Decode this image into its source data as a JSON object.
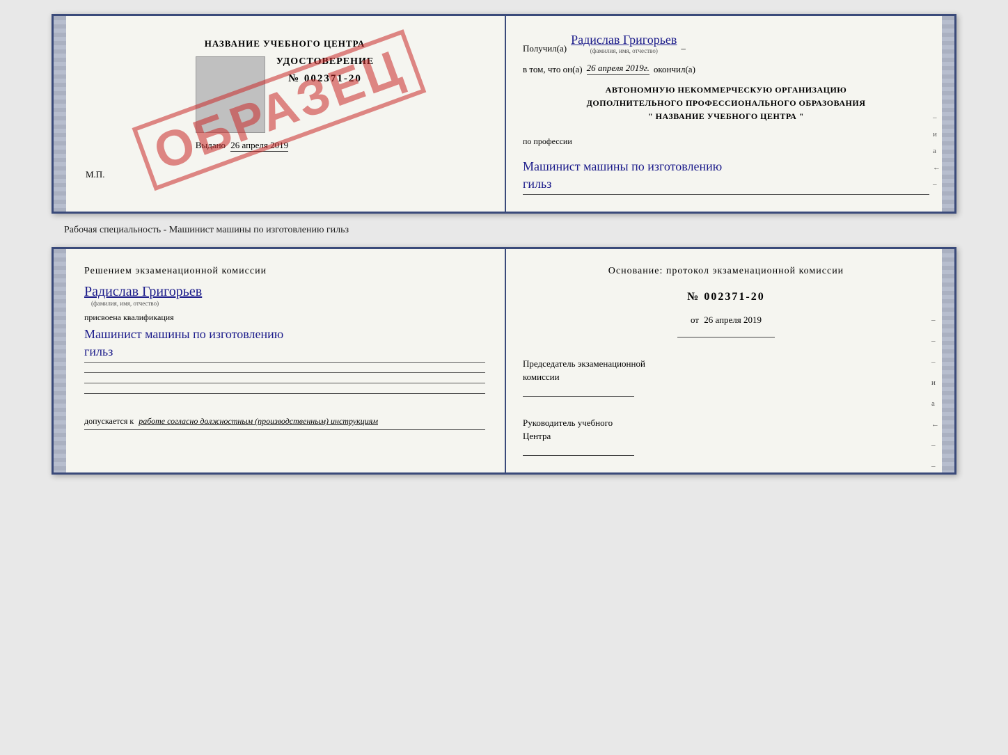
{
  "top_doc": {
    "left": {
      "title": "НАЗВАНИЕ УЧЕБНОГО ЦЕНТРА",
      "obrazec": "ОБРАЗЕЦ",
      "udostoverenie": "УДОСТОВЕРЕНИЕ",
      "number": "№ 002371-20",
      "vibano_prefix": "Выдано",
      "vibano_date": "26 апреля 2019",
      "mp": "М.П."
    },
    "right": {
      "poluchil_prefix": "Получил(а)",
      "name": "Радислав Григорьев",
      "name_sublabel": "(фамилия, имя, отчество)",
      "vtom_prefix": "в том, что он(а)",
      "vtom_date": "26 апреля 2019г.",
      "vtom_suffix": "окончил(а)",
      "org_line1": "АВТОНОМНУЮ НЕКОММЕРЧЕСКУЮ ОРГАНИЗАЦИЮ",
      "org_line2": "ДОПОЛНИТЕЛЬНОГО ПРОФЕССИОНАЛЬНОГО ОБРАЗОВАНИЯ",
      "org_line3": "\"   НАЗВАНИЕ УЧЕБНОГО ЦЕНТРА   \"",
      "profession_label": "по профессии",
      "profession_text": "Машинист машины по изготовлению",
      "profession_text2": "гильз",
      "side_marks": [
        "и",
        "а",
        "←",
        "–",
        "–"
      ]
    }
  },
  "between_label": "Рабочая специальность - Машинист машины по изготовлению гильз",
  "bottom_doc": {
    "left": {
      "resheniem": "Решением  экзаменационной  комиссии",
      "name": "Радислав Григорьев",
      "name_sublabel": "(фамилия, имя, отчество)",
      "prisvoena": "присвоена квалификация",
      "qualification1": "Машинист машины по изготовлению",
      "qualification2": "гильз",
      "dopuskaetsya_prefix": "допускается к",
      "dopuskaetsya_text": "работе согласно должностным (производственным) инструкциям"
    },
    "right": {
      "osnovanie": "Основание: протокол экзаменационной  комиссии",
      "number": "№  002371-20",
      "ot_prefix": "от",
      "ot_date": "26 апреля 2019",
      "predsedatel1": "Председатель экзаменационной",
      "predsedatel2": "комиссии",
      "rukovoditel1": "Руководитель учебного",
      "rukovoditel2": "Центра",
      "side_marks": [
        "–",
        "–",
        "–",
        "и",
        "а",
        "←",
        "–",
        "–",
        "–",
        "–"
      ]
    }
  }
}
